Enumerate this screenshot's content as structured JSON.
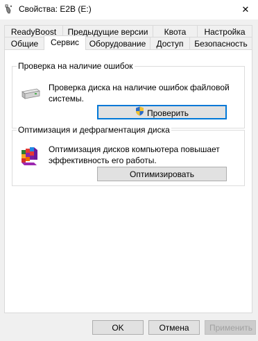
{
  "window": {
    "title": "Свойства: E2B (E:)",
    "app_icon": "usb-drive-icon",
    "close_glyph": "✕"
  },
  "tabs": {
    "row1": [
      {
        "label": "ReadyBoost"
      },
      {
        "label": "Предыдущие версии"
      },
      {
        "label": "Квота"
      },
      {
        "label": "Настройка"
      }
    ],
    "row2": [
      {
        "label": "Общие"
      },
      {
        "label": "Сервис",
        "selected": true
      },
      {
        "label": "Оборудование"
      },
      {
        "label": "Доступ"
      },
      {
        "label": "Безопасность"
      }
    ]
  },
  "error_check": {
    "title": "Проверка на наличие ошибок",
    "description": "Проверка диска на наличие ошибок файловой системы.",
    "button_label": "Проверить",
    "icon": "drive-icon",
    "button_icon": "uac-shield-icon"
  },
  "optimize": {
    "title": "Оптимизация и дефрагментация диска",
    "description": "Оптимизация дисков компьютера повышает эффективность его работы.",
    "button_label": "Оптимизировать",
    "icon": "defrag-icon"
  },
  "footer": {
    "ok_label": "OK",
    "cancel_label": "Отмена",
    "apply_label": "Применить"
  },
  "colors": {
    "accent": "#0078d7",
    "window_bg": "#f0f0f0",
    "panel_bg": "#ffffff"
  }
}
